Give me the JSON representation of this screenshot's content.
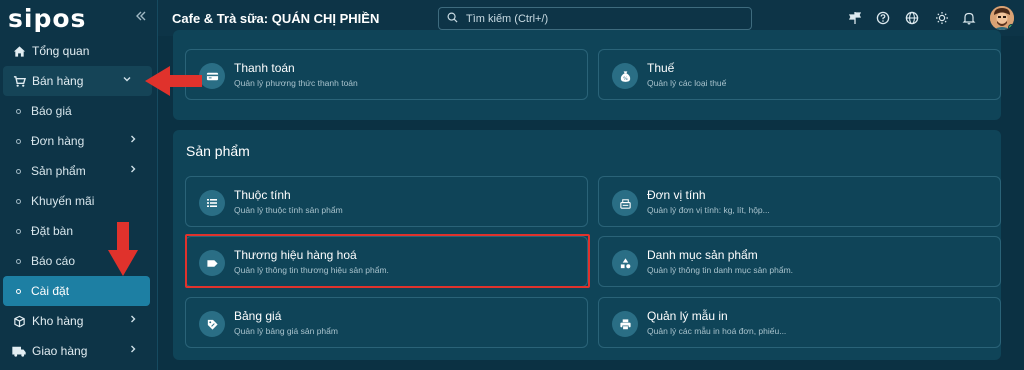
{
  "brand": {
    "logo_text": "sipos"
  },
  "topbar": {
    "store_title": "Cafe & Trà sữa: QUÁN CHỊ PHIỀN",
    "search_placeholder": "Tìm kiếm (Ctrl+/)",
    "icons": [
      "flag-icon",
      "help-icon",
      "globe-icon",
      "theme-icon",
      "bell-icon"
    ]
  },
  "sidebar": {
    "items": [
      {
        "label": "Tổng quan",
        "icon": "home-icon"
      },
      {
        "label": "Bán hàng",
        "icon": "cart-icon"
      },
      {
        "label": "Báo giá"
      },
      {
        "label": "Đơn hàng"
      },
      {
        "label": "Sản phẩm"
      },
      {
        "label": "Khuyến mãi"
      },
      {
        "label": "Đặt bàn"
      },
      {
        "label": "Báo cáo"
      },
      {
        "label": "Cài đặt"
      },
      {
        "label": "Kho hàng",
        "icon": "box-icon"
      },
      {
        "label": "Giao hàng",
        "icon": "truck-icon"
      }
    ]
  },
  "settings": {
    "top_cards": [
      {
        "title": "Thanh toán",
        "desc": "Quản lý phương thức thanh toán"
      },
      {
        "title": "Thuế",
        "desc": "Quản lý các loại thuế"
      }
    ],
    "products_section": {
      "title": "Sản phẩm",
      "cards": [
        {
          "title": "Thuộc tính",
          "desc": "Quản lý thuộc tính sản phẩm"
        },
        {
          "title": "Đơn vị tính",
          "desc": "Quản lý đơn vị tính: kg, lít, hộp..."
        },
        {
          "title": "Thương hiệu hàng hoá",
          "desc": "Quản lý thông tin thương hiệu sản phẩm."
        },
        {
          "title": "Danh mục sản phẩm",
          "desc": "Quản lý thông tin danh mục sản phẩm."
        },
        {
          "title": "Bảng giá",
          "desc": "Quản lý bảng giá sản phẩm"
        },
        {
          "title": "Quản lý mẫu in",
          "desc": "Quản lý các mẫu in hoá đơn, phiếu..."
        }
      ]
    }
  },
  "colors": {
    "annotation_red": "#e0322c",
    "active_nav": "#1d7fa3",
    "panel_bg": "#0f4458"
  }
}
